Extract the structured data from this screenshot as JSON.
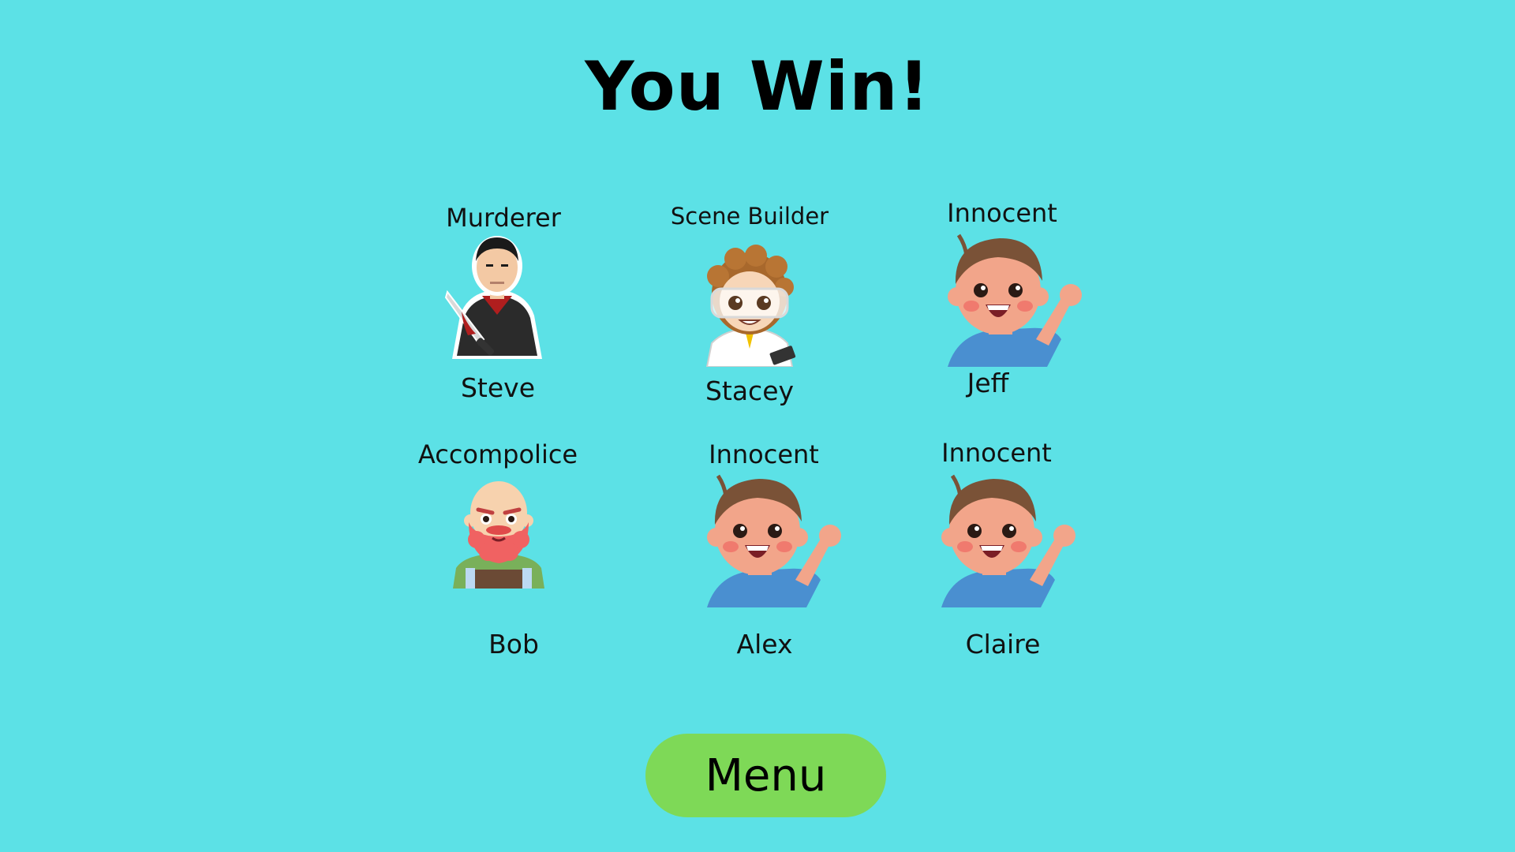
{
  "screen": {
    "title": "You Win!"
  },
  "characters": [
    {
      "role": "Murderer",
      "name": "Steve",
      "avatar": "murderer-with-knife-icon"
    },
    {
      "role": "Scene Builder",
      "name": "Stacey",
      "avatar": "scientist-with-goggles-icon"
    },
    {
      "role": "Innocent",
      "name": "Jeff",
      "avatar": "waving-boy-icon"
    },
    {
      "role": "Accompolice",
      "name": "Bob",
      "avatar": "bald-bearded-man-icon"
    },
    {
      "role": "Innocent",
      "name": "Alex",
      "avatar": "waving-boy-icon"
    },
    {
      "role": "Innocent",
      "name": "Claire",
      "avatar": "waving-boy-icon"
    }
  ],
  "menu_button": {
    "label": "Menu",
    "color": "#7ed957"
  },
  "colors": {
    "background": "#5ce1e6",
    "text": "#111111"
  }
}
